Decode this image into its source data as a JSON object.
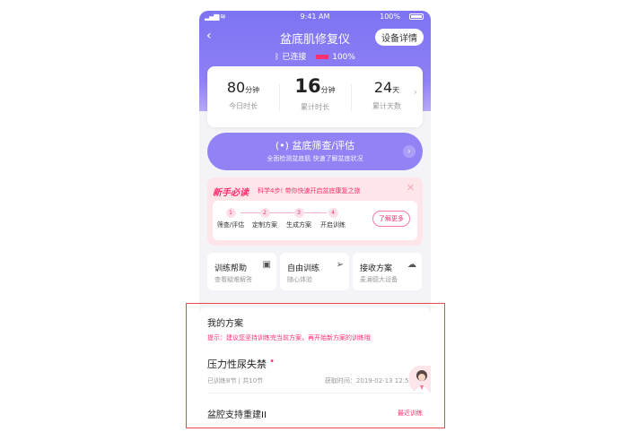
{
  "status_bar": {
    "time": "9:41 AM",
    "battery_text": "100%"
  },
  "header": {
    "back_icon": "chevron-left-icon",
    "title": "盆底肌修复仪",
    "device_button": "设备详情",
    "connection_text": "已连接",
    "device_battery": "100%",
    "battery_color": "#ff2e6f"
  },
  "stats": [
    {
      "value": "80",
      "unit": "分钟",
      "label": "今日时长"
    },
    {
      "value": "16",
      "unit": "分钟",
      "label": "累计时长"
    },
    {
      "value": "24",
      "unit": "天",
      "label": "累计天数"
    }
  ],
  "screening": {
    "icon": "scan-icon",
    "title": "盆底筛查/评估",
    "subtitle": "全面检测盆底肌 快速了解盆底状况"
  },
  "guide": {
    "title": "新手必读",
    "description": "科学4步! 带你快速开启盆底康复之旅",
    "steps": [
      {
        "num": "1",
        "label": "筛查/评估"
      },
      {
        "num": "2",
        "label": "定制方案"
      },
      {
        "num": "3",
        "label": "生成方案"
      },
      {
        "num": "4",
        "label": "开启训练"
      }
    ],
    "more_button": "了解更多"
  },
  "quick_cards": [
    {
      "title": "训练帮助",
      "subtitle": "查看疑难解答",
      "icon": "help-book-icon"
    },
    {
      "title": "自由训练",
      "subtitle": "随心体验",
      "icon": "paper-plane-icon"
    },
    {
      "title": "接收方案",
      "subtitle": "麦澜德大设备",
      "icon": "cloud-download-icon"
    }
  ],
  "plan": {
    "heading": "我的方案",
    "tip": "提示：建议您坚持训练完当前方案，再开始新方案的训练哦",
    "items": [
      {
        "name": "压力性尿失禁",
        "progress": "已训练8节 | 共10节",
        "date": "获取时间：2019-02-13 12:50"
      },
      {
        "name": "盆腔支持重建II",
        "action": "最近训练"
      }
    ]
  },
  "colors": {
    "accent": "#7d73f2",
    "pink": "#ff2f6e",
    "highlight_border": "#e2494b"
  }
}
